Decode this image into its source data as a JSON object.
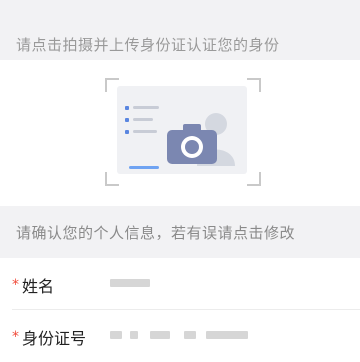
{
  "top_hint": "请点击拍摄并上传身份证认证您的身份",
  "mid_hint": "请确认您的个人信息，若有误请点击修改",
  "fields": [
    {
      "label": "姓名",
      "required_mark": "*",
      "value": ""
    },
    {
      "label": "身份证号",
      "required_mark": "*",
      "value": ""
    }
  ],
  "colors": {
    "required": "#f04b3a",
    "camera": "#7b87b1",
    "accent": "#6fa3f2"
  },
  "icons": {
    "upload": "camera-icon",
    "card": "id-card-icon",
    "avatar": "person-silhouette-icon"
  }
}
